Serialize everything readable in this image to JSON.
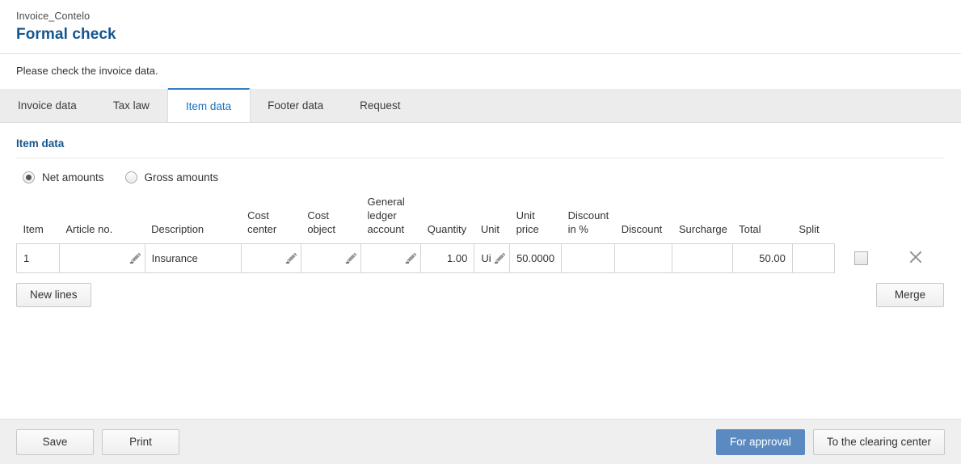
{
  "header": {
    "breadcrumb": "Invoice_Contelo",
    "title": "Formal check",
    "instruction": "Please check the invoice data."
  },
  "tabs": [
    {
      "label": "Invoice data",
      "active": false
    },
    {
      "label": "Tax law",
      "active": false
    },
    {
      "label": "Item data",
      "active": true
    },
    {
      "label": "Footer data",
      "active": false
    },
    {
      "label": "Request",
      "active": false
    }
  ],
  "section": {
    "title": "Item data"
  },
  "amount_mode": {
    "options": [
      {
        "label": "Net amounts",
        "selected": true
      },
      {
        "label": "Gross amounts",
        "selected": false
      }
    ]
  },
  "table": {
    "columns": [
      "Item",
      "Article no.",
      "Description",
      "Cost center",
      "Cost object",
      "General ledger account",
      "Quantity",
      "Unit",
      "Unit price",
      "Discount in %",
      "Discount",
      "Surcharge",
      "Total",
      "Split"
    ],
    "rows": [
      {
        "item": "1",
        "article_no": "",
        "description": "Insurance",
        "cost_center": "",
        "cost_object": "",
        "general_ledger_account": "",
        "quantity": "1.00",
        "unit": "Ui",
        "unit_price": "50.0000",
        "discount_percent": "",
        "discount": "",
        "surcharge": "",
        "total": "50.00",
        "split": "",
        "checkbox_checked": false
      }
    ]
  },
  "actions": {
    "new_lines": "New lines",
    "merge": "Merge"
  },
  "footer": {
    "save": "Save",
    "print": "Print",
    "for_approval": "For approval",
    "to_clearing_center": "To the clearing center"
  },
  "colors": {
    "title_blue": "#14568f",
    "tab_active_blue": "#1a74c0",
    "primary_button": "#5b8ac0",
    "tabbar_bg": "#ececec",
    "footer_bg": "#efefef",
    "border": "#d4d4d4"
  },
  "icons": {
    "pencil": "pencil-icon",
    "close": "close-icon",
    "checkbox": "checkbox-icon"
  }
}
